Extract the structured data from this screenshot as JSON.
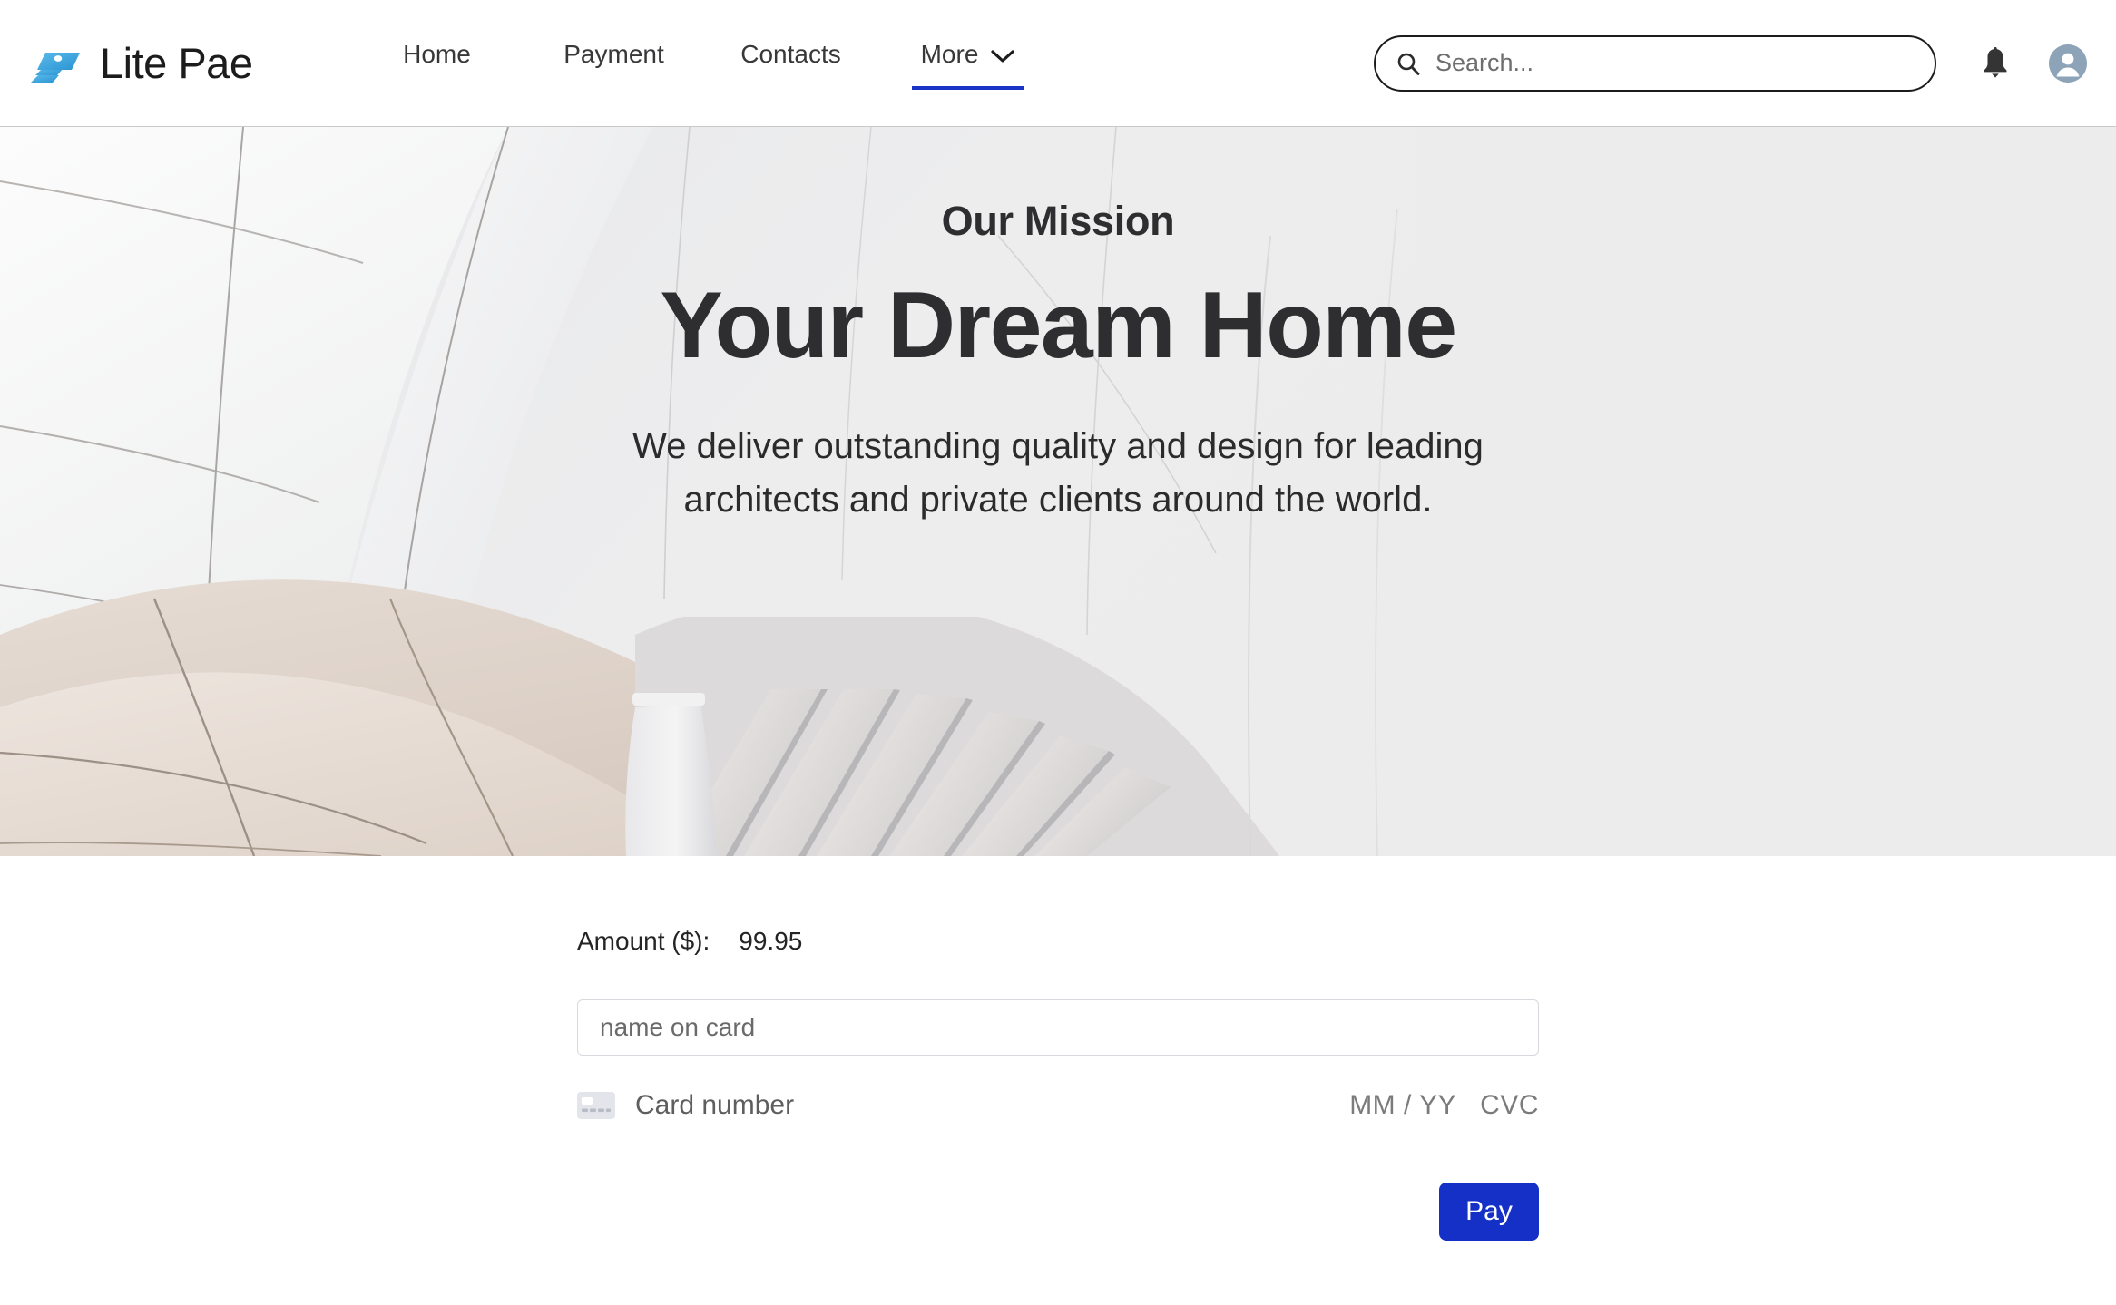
{
  "header": {
    "brand": {
      "name": "Lite Pae",
      "logo_icon": "stacked-cards-logo",
      "color": "#3aa6e0"
    },
    "nav": [
      {
        "label": "Home",
        "active": false,
        "has_chevron": false
      },
      {
        "label": "Payment",
        "active": false,
        "has_chevron": false
      },
      {
        "label": "Contacts",
        "active": false,
        "has_chevron": false
      },
      {
        "label": "More",
        "active": true,
        "has_chevron": true
      }
    ],
    "active_underline_color": "#1a34c8",
    "search": {
      "placeholder": "Search...",
      "value": "",
      "icon": "search-icon"
    },
    "notifications_icon": "bell-icon",
    "account_icon": "user-avatar-icon",
    "avatar_color": "#8da3b8"
  },
  "hero": {
    "eyebrow": "Our Mission",
    "title": "Your Dream Home",
    "subtitle": "We deliver outstanding quality and design for leading architects and private clients around the world.",
    "background_image": "architecture-curved-white-panels-photo",
    "background_fallback_color": "#ececec"
  },
  "payment": {
    "amount_label": "Amount ($):",
    "amount_value": "99.95",
    "name_on_card_placeholder": "name on card",
    "name_on_card_value": "",
    "card_icon": "credit-card-icon",
    "card_number_placeholder": "Card number",
    "expiry_placeholder": "MM / YY",
    "cvc_placeholder": "CVC",
    "pay_button_label": "Pay",
    "pay_button_color": "#1430c7"
  }
}
